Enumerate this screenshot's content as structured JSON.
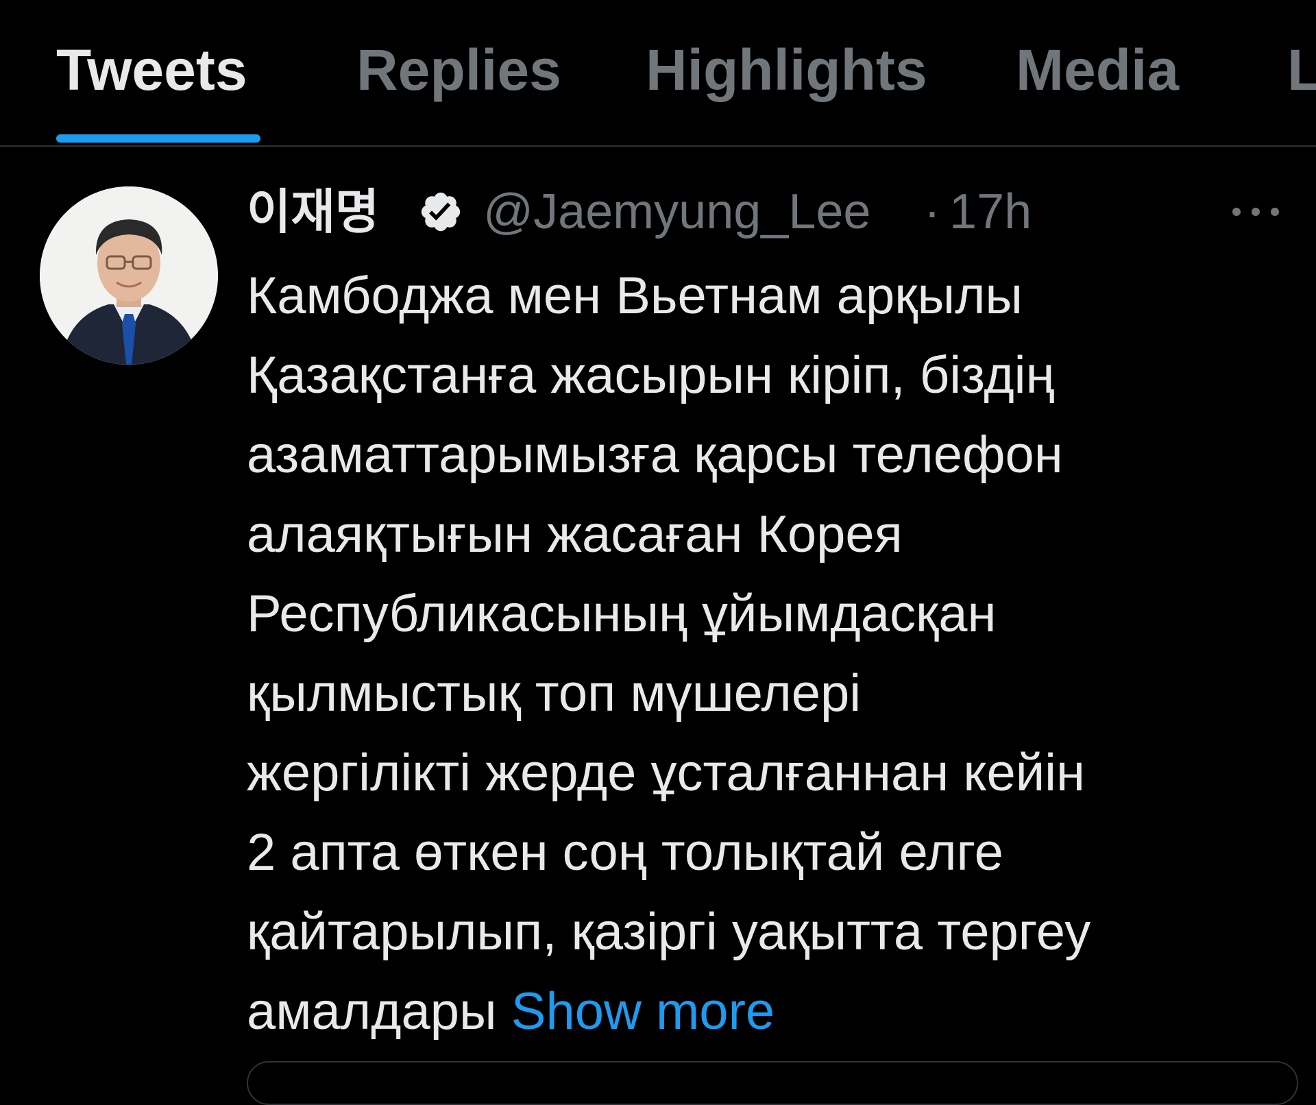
{
  "tabs": [
    {
      "label": "Tweets",
      "active": true
    },
    {
      "label": "Replies",
      "active": false
    },
    {
      "label": "Highlights",
      "active": false
    },
    {
      "label": "Media",
      "active": false
    },
    {
      "label": "L",
      "active": false
    }
  ],
  "tweet": {
    "display_name": "이재명",
    "verified_icon": "verified-badge-icon",
    "handle": "@Jaemyung_Lee",
    "separator": "·",
    "time": "17h",
    "more_icon": "more-horizontal-icon",
    "text_lines": [
      "Камбоджа мен Вьетнам арқылы",
      "Қазақстанға жасырын кіріп, біздің",
      "азаматтарымызға қарсы телефон",
      "алаяқтығын жасаған Корея",
      "Республикасының ұйымдасқан",
      "қылмыстық топ мүшелері",
      "жергілікті жерде ұсталғаннан кейін",
      "2 апта өткен соң толықтай елге",
      "қайтарылып, қазіргі уақытта тергеу"
    ],
    "last_line_text": "амалдары",
    "show_more_label": "Show more"
  },
  "colors": {
    "background": "#000000",
    "text_primary": "#e7e9ea",
    "text_secondary": "#71767b",
    "accent": "#1d9bf0",
    "divider": "#2f3336"
  }
}
